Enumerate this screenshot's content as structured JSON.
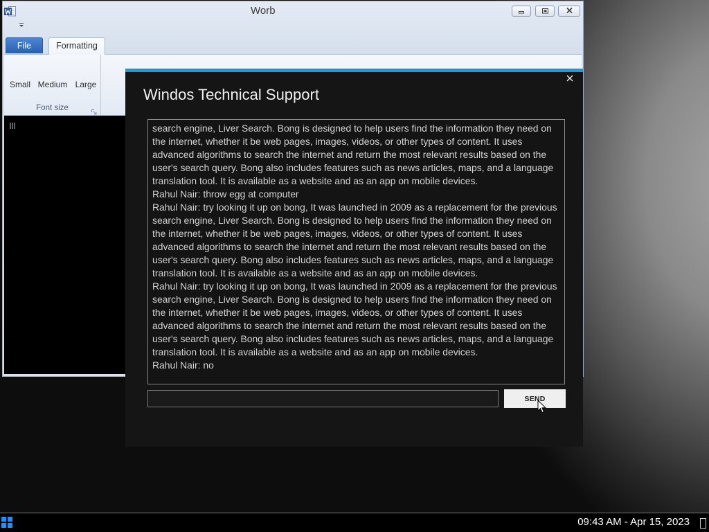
{
  "window": {
    "title": "Worb",
    "app_icon": "word-app-icon",
    "controls": [
      "minimize-icon",
      "maximize-icon",
      "close-icon"
    ],
    "quick_access_icon": "chevron-down-icon",
    "tabs": [
      {
        "label": "File",
        "active": false
      },
      {
        "label": "Formatting",
        "active": true
      }
    ],
    "ribbon": {
      "groups": [
        {
          "label": "Font size",
          "buttons": [
            {
              "label": "Small"
            },
            {
              "label": "Medium"
            },
            {
              "label": "Large"
            }
          ],
          "launcher_icon": "dialog-launcher-icon"
        }
      ]
    },
    "document": {
      "marker_icon": "caret-marker-icon"
    }
  },
  "support_dialog": {
    "title": "Windos Technical Support",
    "accent_color": "#1e9bd7",
    "close_icon": "close-icon",
    "chat": {
      "messages": [
        {
          "lines": [
            "search engine, Liver Search. Bong is designed to help users find the information they need on",
            "the internet, whether it be web pages, images, videos, or other types of content. It uses",
            "advanced algorithms to search the internet and return the most relevant results based on the",
            "user's search query. Bong also includes features such as news articles, maps, and a language",
            "translation tool. It is available as a website and as an app on mobile devices."
          ]
        },
        {
          "lines": [
            "Rahul Nair: throw egg at computer"
          ]
        },
        {
          "lines": [
            "Rahul Nair: try looking it up on bong, It was launched in 2009 as a replacement for the previous",
            "search engine, Liver Search. Bong is designed to help users find the information they need on",
            "the internet, whether it be web pages, images, videos, or other types of content. It uses",
            "advanced algorithms to search the internet and return the most relevant results based on the",
            "user's search query. Bong also includes features such as news articles, maps, and a language",
            "translation tool. It is available as a website and as an app on mobile devices."
          ]
        },
        {
          "lines": [
            "Rahul Nair: try looking it up on bong, It was launched in 2009 as a replacement for the previous",
            "search engine, Liver Search. Bong is designed to help users find the information they need on",
            "the internet, whether it be web pages, images, videos, or other types of content. It uses",
            "advanced algorithms to search the internet and return the most relevant results based on the",
            "user's search query. Bong also includes features such as news articles, maps, and a language",
            "translation tool. It is available as a website and as an app on mobile devices."
          ]
        },
        {
          "lines": [
            "Rahul Nair: no"
          ]
        }
      ]
    },
    "input": {
      "value": ""
    },
    "send_label": "SEND"
  },
  "taskbar": {
    "start_icon": "windows-logo-icon",
    "clock": "09:43 AM - Apr 15, 2023",
    "show_desktop_icon": "show-desktop-icon"
  },
  "pointer": {
    "icon": "mouse-pointer-icon"
  }
}
